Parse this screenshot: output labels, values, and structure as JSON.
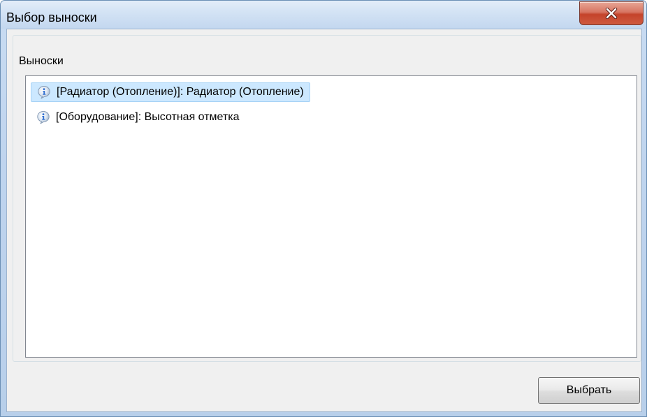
{
  "window": {
    "title": "Выбор выноски",
    "close_icon": "close-x-icon"
  },
  "group": {
    "label": "Выноски"
  },
  "list": {
    "items": [
      {
        "label": "[Радиатор (Отопление)]: Радиатор (Отопление)",
        "icon": "info-icon",
        "selected": true
      },
      {
        "label": "[Оборудование]: Высотная отметка",
        "icon": "info-icon",
        "selected": false
      }
    ]
  },
  "buttons": {
    "select_label": "Выбрать"
  },
  "colors": {
    "selection_background": "#cce8ff",
    "close_button": "#c4432b",
    "icon_blue": "#3a7bd5"
  }
}
